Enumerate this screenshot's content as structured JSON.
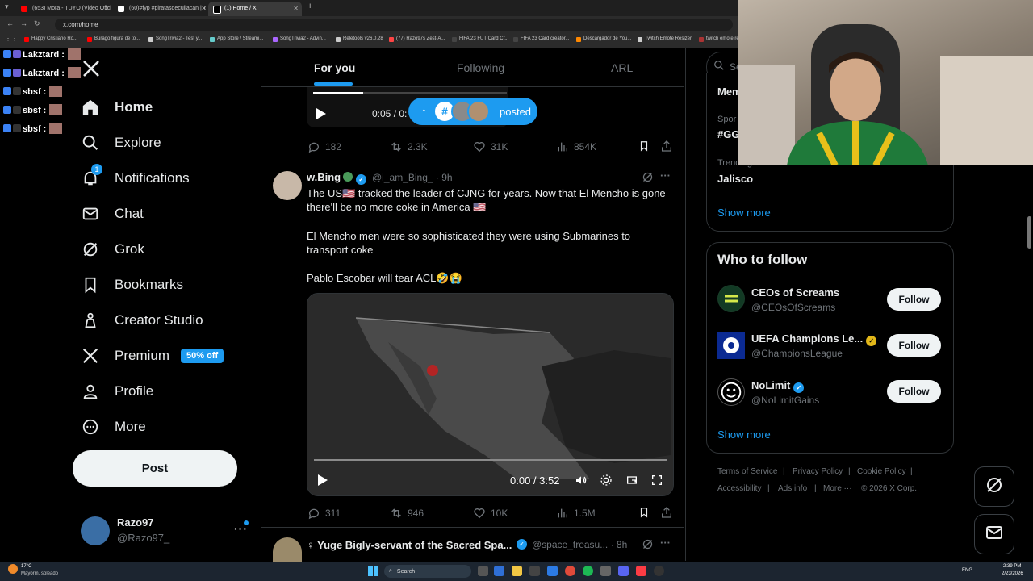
{
  "browser": {
    "tabs": [
      {
        "label": "(653) Mora - TUYO (Video Ofici",
        "color": "#ff0000"
      },
      {
        "label": "(60)#fyp #piratasdeculiacan | Ti",
        "color": "#ffffff"
      },
      {
        "label": "(1) Home / X",
        "color": "#ffffff"
      }
    ],
    "url": "x.com/home",
    "bookmarks": [
      "Happy Cristiano Ro...",
      "Burago figura de to...",
      "SongTrivia2 - Test y...",
      "App Store / Streami...",
      "SongTrivia2 - Advin...",
      "Reletools v26.0.28",
      "(77) Razo97s Zest-A...",
      "FIFA 23 FUT Card Cr...",
      "FIFA 23 Card creator...",
      "Descargador de You...",
      "Twitch Emote Resizer",
      "twitch emote re"
    ]
  },
  "chat_overlay": [
    {
      "user": "Lakztard :"
    },
    {
      "user": "Lakztard :"
    },
    {
      "user": "sbsf :"
    },
    {
      "user": "sbsf :"
    },
    {
      "user": "sbsf :"
    }
  ],
  "nav": {
    "items": [
      {
        "label": "Home",
        "icon": "home-icon"
      },
      {
        "label": "Explore",
        "icon": "search-icon"
      },
      {
        "label": "Notifications",
        "icon": "bell-icon",
        "badge": "1"
      },
      {
        "label": "Chat",
        "icon": "mail-icon"
      },
      {
        "label": "Grok",
        "icon": "grok-icon"
      },
      {
        "label": "Bookmarks",
        "icon": "bookmark-icon"
      },
      {
        "label": "Creator Studio",
        "icon": "creator-studio-icon"
      },
      {
        "label": "Premium",
        "icon": "x-logo-icon",
        "badge": "50% off"
      },
      {
        "label": "Profile",
        "icon": "person-icon"
      },
      {
        "label": "More",
        "icon": "more-circle-icon"
      }
    ],
    "post_label": "Post",
    "account": {
      "name": "Razo97",
      "handle": "@Razo97_"
    }
  },
  "feed": {
    "tabs": [
      "For you",
      "Following",
      "ARL"
    ],
    "new_posts_pill": "posted",
    "prev_tweet": {
      "video_time": "0:05 / 0:",
      "replies": "182",
      "reposts": "2.3K",
      "likes": "31K",
      "views": "854K"
    },
    "tweet": {
      "name": "w.Bing",
      "handle": "@i_am_Bing_",
      "time": "· 9h",
      "text1": "The US🇺🇸 tracked the leader of CJNG for years. Now that El Mencho is gone there'll be no more coke in America 🇺🇸",
      "text2": "El Mencho men were so sophisticated they were using Submarines to transport coke",
      "text3": "Pablo Escobar will tear ACL🤣😭",
      "video_time": "0:00 / 3:52",
      "video_progress": 0.0,
      "replies": "311",
      "reposts": "946",
      "likes": "10K",
      "views": "1.5M"
    },
    "next_tweet": {
      "name": "♀ Yuge Bigly-servant of the Sacred Spa...",
      "handle": "@space_treasu...",
      "time": "· 8h"
    }
  },
  "right": {
    "search_placeholder": "Se",
    "trends": {
      "header_partial": "Mem",
      "sports_label": "Spor",
      "sports_tag": "#GG",
      "trending_label": "Trending in Mexico",
      "trending_topic": "Jalisco",
      "show_more": "Show more"
    },
    "who_to_follow": {
      "title": "Who to follow",
      "accounts": [
        {
          "name": "CEOs of Screams",
          "handle": "@CEOsOfScreams",
          "verified": false
        },
        {
          "name": "UEFA Champions Le...",
          "handle": "@ChampionsLeague",
          "verified": true,
          "verified_color": "#e2b719"
        },
        {
          "name": "NoLimit",
          "handle": "@NoLimitGains",
          "verified": true,
          "verified_color": "#1d9bf0"
        }
      ],
      "follow_label": "Follow",
      "show_more": "Show more"
    },
    "footer": {
      "row1": [
        "Terms of Service",
        "|",
        "Privacy Policy",
        "|",
        "Cookie Policy",
        "|"
      ],
      "row2": [
        "Accessibility",
        "|",
        "Ads info",
        "|",
        "More ···",
        "© 2026 X Corp."
      ]
    }
  },
  "taskbar": {
    "weather_temp": "17°C",
    "weather_desc": "Mayorm. soleado",
    "search": "Search",
    "lang": "ENG",
    "time": "2:39 PM",
    "date": "2/23/2026"
  },
  "colors": {
    "accent": "#1d9bf0",
    "bg": "#000000",
    "text": "#e7e9ea",
    "muted": "#71767b"
  }
}
